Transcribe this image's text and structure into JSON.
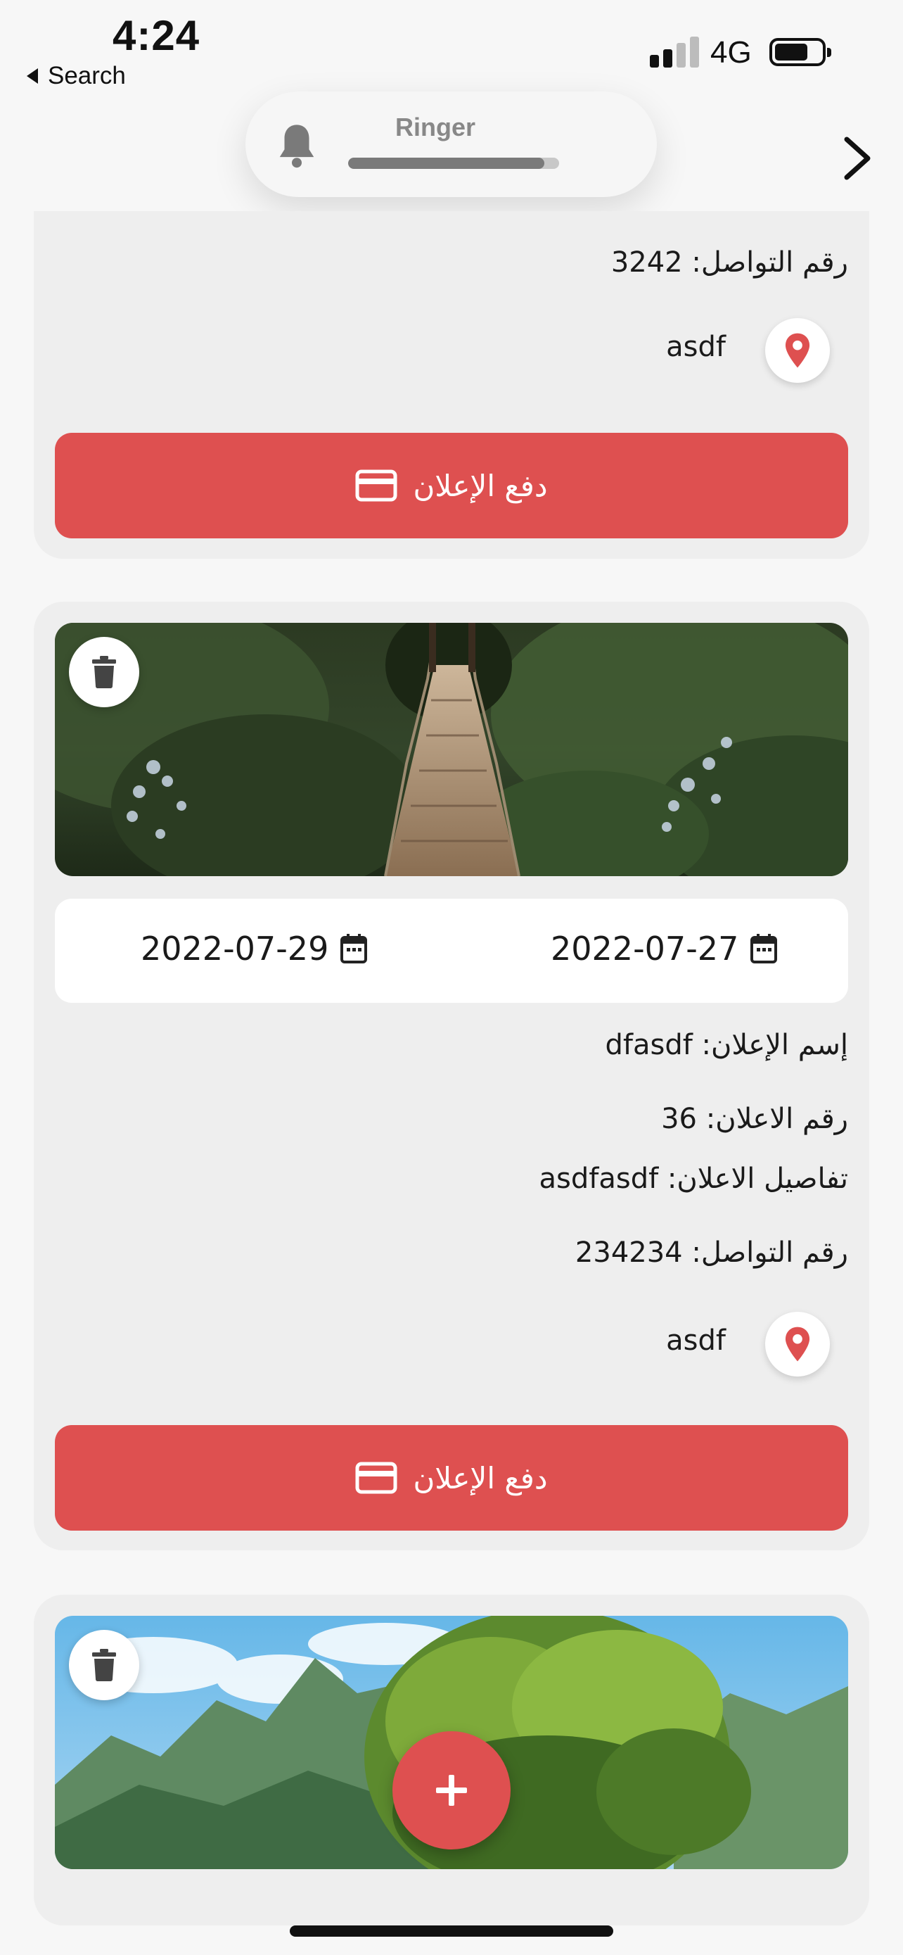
{
  "status_bar": {
    "time": "4:24",
    "back_label": "Search",
    "network": "4G",
    "signal_bars_active": 2,
    "signal_bars_total": 4,
    "battery_level": 0.7
  },
  "ringer": {
    "label": "Ringer",
    "level": 0.93
  },
  "colors": {
    "accent": "#de5050",
    "card_bg": "#eeeeee",
    "page_bg": "#f7f7f7"
  },
  "ads": [
    {
      "contact_line": "رقم التواصل: 3242",
      "location": "asdf",
      "pay_label": "دفع الإعلان"
    },
    {
      "image": "suspension bridge in forest",
      "start_date": "2022-07-27",
      "end_date": "2022-07-29",
      "name_line": "إسم الإعلان: dfasdf",
      "number_line": "رقم الاعلان: 36",
      "details_line": "تفاصيل الاعلان: asdfasdf",
      "contact_line": "رقم التواصل: 234234",
      "location": "asdf",
      "pay_label": "دفع الإعلان"
    },
    {
      "image": "tree with mountains"
    }
  ],
  "icons": {
    "bell": "bell-icon",
    "chevron": "chevron-right-icon",
    "location": "map-pin-icon",
    "card": "credit-card-icon",
    "trash": "trash-icon",
    "calendar": "calendar-icon",
    "add": "plus-icon"
  }
}
